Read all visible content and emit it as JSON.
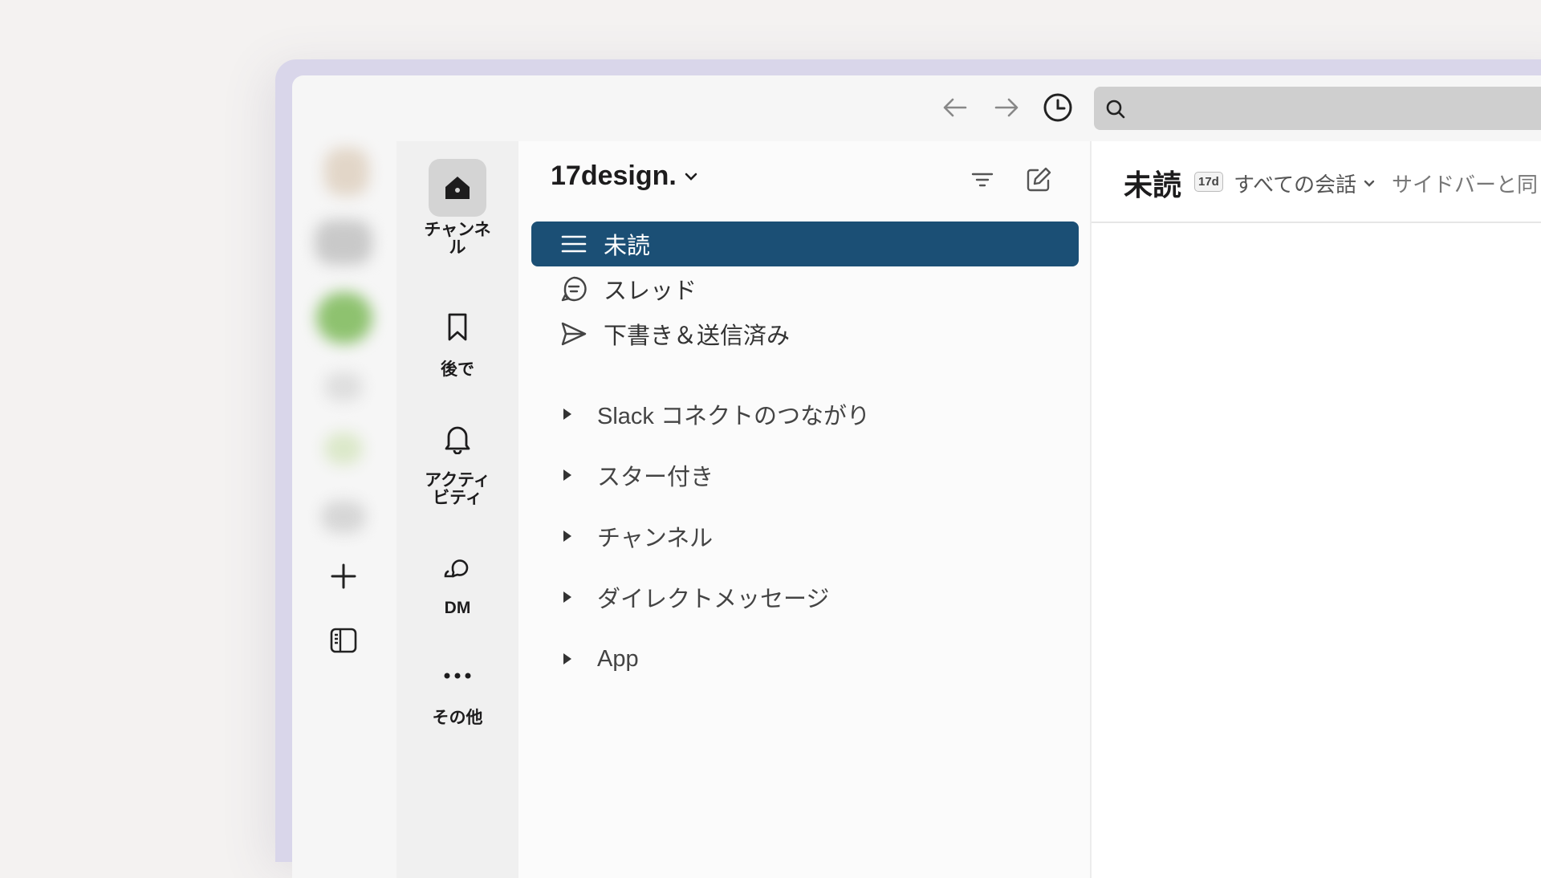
{
  "workspace": {
    "name": "17design."
  },
  "nav": [
    {
      "label": "チャンネ\nル",
      "icon": "home-icon",
      "active": true
    },
    {
      "label": "後で",
      "icon": "bookmark-icon"
    },
    {
      "label": "アクティ\nビティ",
      "icon": "bell-icon"
    },
    {
      "label": "DM",
      "icon": "dm-icon"
    },
    {
      "label": "その他",
      "icon": "more-icon"
    }
  ],
  "sidebar": {
    "items": [
      {
        "label": "未読",
        "icon": "list-icon",
        "active": true
      },
      {
        "label": "スレッド",
        "icon": "threads-icon"
      },
      {
        "label": "下書き＆送信済み",
        "icon": "send-icon"
      }
    ],
    "sections": [
      {
        "label": "Slack コネクトのつながり"
      },
      {
        "label": "スター付き"
      },
      {
        "label": "チャンネル"
      },
      {
        "label": "ダイレクトメッセージ"
      },
      {
        "label": "App"
      }
    ]
  },
  "main": {
    "title": "未読",
    "badge": "17d",
    "filter": "すべての会話",
    "note": "サイドバーと同"
  },
  "colors": {
    "active": "#1b4f75",
    "frame": "#d9d6ea"
  }
}
